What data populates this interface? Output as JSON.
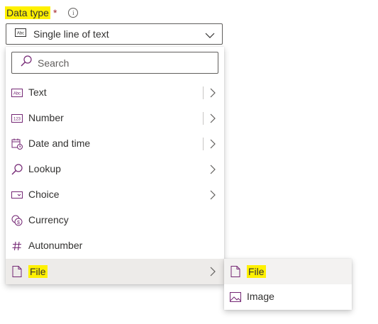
{
  "field": {
    "label": "Data type",
    "required_mark": "*",
    "info_glyph": "i"
  },
  "dropdown": {
    "value": "Single line of text",
    "icon": "abc-text-icon"
  },
  "search": {
    "placeholder": "Search"
  },
  "menu": {
    "items": [
      {
        "label": "Text",
        "icon": "abc-text-icon",
        "has_submenu": true,
        "split": true
      },
      {
        "label": "Number",
        "icon": "number-123-icon",
        "has_submenu": true,
        "split": true
      },
      {
        "label": "Date and time",
        "icon": "calendar-clock-icon",
        "has_submenu": true,
        "split": true
      },
      {
        "label": "Lookup",
        "icon": "search-icon",
        "has_submenu": true,
        "split": false
      },
      {
        "label": "Choice",
        "icon": "choice-icon",
        "has_submenu": true,
        "split": false
      },
      {
        "label": "Currency",
        "icon": "currency-icon",
        "has_submenu": false,
        "split": false
      },
      {
        "label": "Autonumber",
        "icon": "hash-icon",
        "has_submenu": false,
        "split": false
      },
      {
        "label": "File",
        "icon": "document-icon",
        "has_submenu": true,
        "split": false,
        "selected": true
      }
    ]
  },
  "submenu": {
    "items": [
      {
        "label": "File",
        "icon": "document-icon",
        "selected": true
      },
      {
        "label": "Image",
        "icon": "image-icon"
      }
    ]
  },
  "colors": {
    "accent": "#742774",
    "highlight": "#fff100",
    "selected_bg": "#edebe9",
    "text": "#323130"
  }
}
